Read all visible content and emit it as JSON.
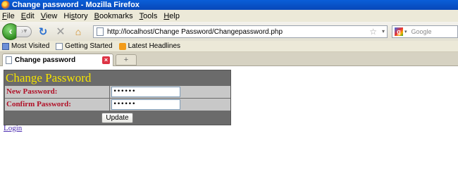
{
  "window": {
    "title": "Change password - Mozilla Firefox"
  },
  "menu": {
    "items": [
      {
        "key": "F",
        "rest": "ile"
      },
      {
        "key": "E",
        "rest": "dit"
      },
      {
        "key": "V",
        "rest": "iew"
      },
      {
        "pre": "Hi",
        "key": "s",
        "rest": "tory"
      },
      {
        "key": "B",
        "rest": "ookmarks"
      },
      {
        "key": "T",
        "rest": "ools"
      },
      {
        "key": "H",
        "rest": "elp"
      }
    ]
  },
  "nav": {
    "url": "http://localhost/Change Password/Changepassword.php",
    "search_placeholder": "Google",
    "icons": {
      "back": "back-arrow-icon",
      "forward": "forward-arrow-icon",
      "reload": "reload-icon",
      "stop": "stop-icon",
      "home": "home-icon"
    }
  },
  "bookmarks": [
    {
      "label": "Most Visited",
      "icon": "bookmark-folder-icon"
    },
    {
      "label": "Getting Started",
      "icon": "page-icon"
    },
    {
      "label": "Latest Headlines",
      "icon": "rss-icon"
    }
  ],
  "tabs": [
    {
      "label": "Change password",
      "active": true
    }
  ],
  "form": {
    "title": "Change Password",
    "new_password_label": "New Password:",
    "new_password_value": "••••••",
    "confirm_password_label": "Confirm Password:",
    "confirm_password_value": "••••••",
    "update_label": "Update"
  },
  "links": {
    "login": "Login"
  },
  "colors": {
    "title_text": "#f4e300",
    "label_text": "#b00f26",
    "table_bg": "#6b6b6b",
    "cell_bg": "#c8c8c8",
    "link": "#4b2bb0"
  }
}
